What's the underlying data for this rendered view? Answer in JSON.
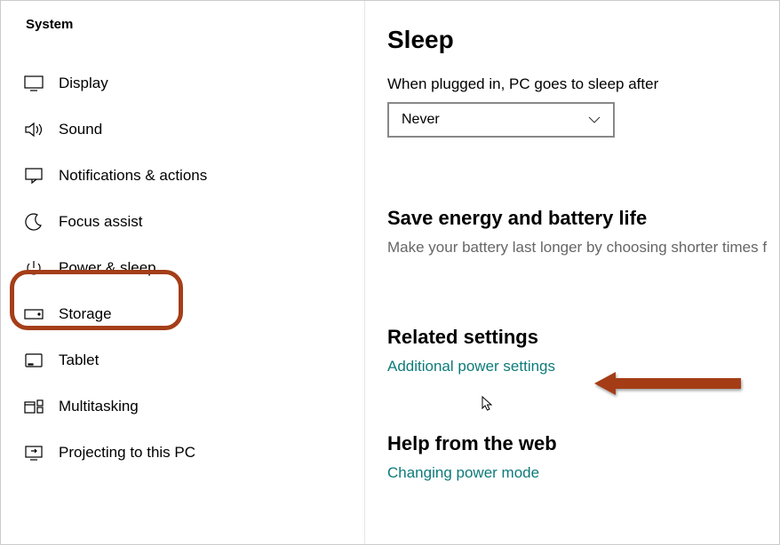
{
  "sidebar": {
    "title": "System",
    "items": [
      {
        "label": "Display"
      },
      {
        "label": "Sound"
      },
      {
        "label": "Notifications & actions"
      },
      {
        "label": "Focus assist"
      },
      {
        "label": "Power & sleep"
      },
      {
        "label": "Storage"
      },
      {
        "label": "Tablet"
      },
      {
        "label": "Multitasking"
      },
      {
        "label": "Projecting to this PC"
      }
    ]
  },
  "main": {
    "sleep": {
      "heading": "Sleep",
      "plugged_label": "When plugged in, PC goes to sleep after",
      "dropdown_value": "Never"
    },
    "save_energy": {
      "heading": "Save energy and battery life",
      "desc": "Make your battery last longer by choosing shorter times f"
    },
    "related": {
      "heading": "Related settings",
      "link": "Additional power settings"
    },
    "help": {
      "heading": "Help from the web",
      "link": "Changing power mode"
    }
  }
}
